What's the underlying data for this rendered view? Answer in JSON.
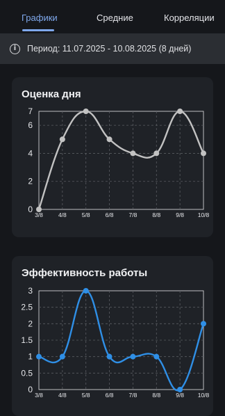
{
  "tabs": [
    {
      "label": "Графики",
      "active": true
    },
    {
      "label": "Средние",
      "active": false
    },
    {
      "label": "Корреляции",
      "active": false
    }
  ],
  "period": {
    "icon": "info-icon",
    "text": "Период: 11.07.2025 - 10.08.2025 (8 дней)"
  },
  "colors": {
    "background": "#15171b",
    "card": "#1f2227",
    "accent": "#7fa8ec",
    "series_mood": "#c2c2c2",
    "series_work": "#2f8fe6"
  },
  "chart_data": [
    {
      "type": "line",
      "title": "Оценка дня",
      "x": [
        "3/8",
        "4/8",
        "5/8",
        "6/8",
        "7/8",
        "8/8",
        "9/8",
        "10/8"
      ],
      "y_ticks": [
        "0",
        "2",
        "4",
        "6",
        "7"
      ],
      "ylim": [
        0,
        7
      ],
      "grid": true,
      "series": [
        {
          "values": [
            0,
            5,
            7,
            5,
            4,
            4,
            7,
            4
          ],
          "color": "#c2c2c2"
        }
      ]
    },
    {
      "type": "line",
      "title": "Эффективность работы",
      "x": [
        "3/8",
        "4/8",
        "5/8",
        "6/8",
        "7/8",
        "8/8",
        "9/8",
        "10/8"
      ],
      "y_ticks": [
        "0",
        "0.5",
        "1",
        "1.5",
        "2",
        "2.5",
        "3"
      ],
      "ylim": [
        0,
        3
      ],
      "grid": true,
      "series": [
        {
          "values": [
            1,
            1,
            3,
            1,
            1,
            1,
            0,
            2
          ],
          "color": "#2f8fe6"
        }
      ]
    }
  ]
}
